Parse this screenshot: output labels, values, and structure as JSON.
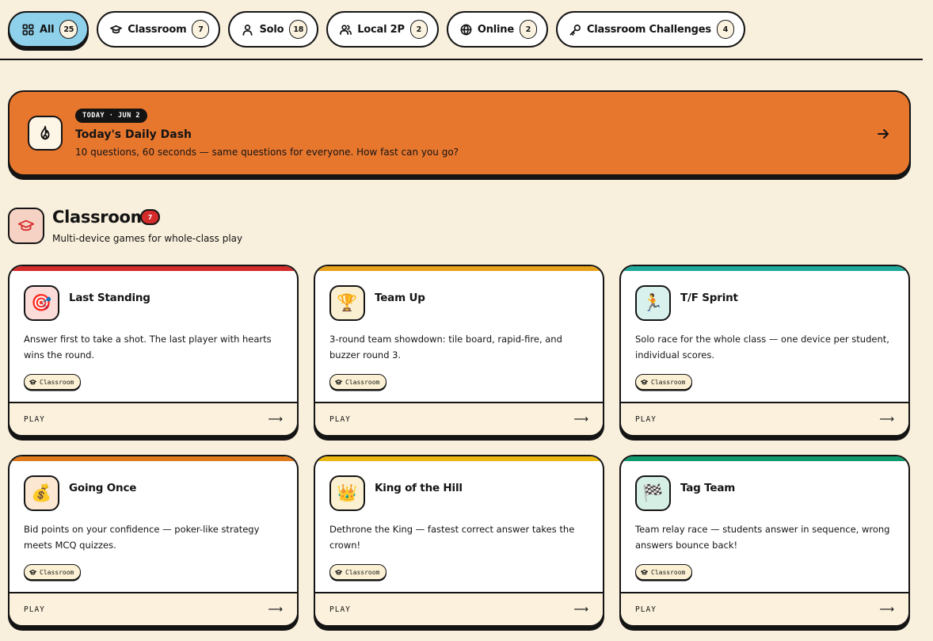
{
  "filters": [
    {
      "label": "All",
      "count": "25",
      "icon": "grid-icon",
      "active": true
    },
    {
      "label": "Classroom",
      "count": "7",
      "icon": "graduation-cap-icon"
    },
    {
      "label": "Solo",
      "count": "18",
      "icon": "user-icon"
    },
    {
      "label": "Local 2P",
      "count": "2",
      "icon": "users-icon"
    },
    {
      "label": "Online",
      "count": "2",
      "icon": "globe-icon"
    },
    {
      "label": "Classroom Challenges",
      "count": "4",
      "icon": "key-icon"
    }
  ],
  "daily": {
    "badge": "TODAY · JUN 2",
    "title": "Today's Daily Dash",
    "description": "10 questions, 60 seconds — same questions for everyone. How fast can you go?",
    "icon": "flame-icon",
    "color": "#e8772e"
  },
  "section": {
    "title": "Classroom",
    "count": "7",
    "subtitle": "Multi-device games for whole-class play",
    "icon": "graduation-cap-icon",
    "color": "#d42b2b"
  },
  "cards": [
    {
      "title": "Last Standing",
      "emoji": "🎯",
      "icon": "target-icon",
      "description": "Answer first to take a shot. The last player with hearts wins the round.",
      "tag": "Classroom",
      "play": "PLAY",
      "stripe": "#d42b2b",
      "icon_bg": "#fbdcd8"
    },
    {
      "title": "Team Up",
      "emoji": "🏆",
      "icon": "trophy-icon",
      "description": "3-round team showdown: tile board, rapid-fire, and buzzer round 3.",
      "tag": "Classroom",
      "play": "PLAY",
      "stripe": "#e8a21a",
      "icon_bg": "#fbefd2"
    },
    {
      "title": "T/F Sprint",
      "emoji": "🏃",
      "icon": "runner-icon",
      "description": "Solo race for the whole class — one device per student, individual scores.",
      "tag": "Classroom",
      "play": "PLAY",
      "stripe": "#1fa99a",
      "icon_bg": "#d8f1ec"
    },
    {
      "title": "Going Once",
      "emoji": "💰",
      "icon": "money-bag-icon",
      "description": "Bid points on your confidence — poker-like strategy meets MCQ quizzes.",
      "tag": "Classroom",
      "play": "PLAY",
      "stripe": "#e07a1a",
      "icon_bg": "#fbe7d2"
    },
    {
      "title": "King of the Hill",
      "emoji": "👑",
      "icon": "crown-icon",
      "description": "Dethrone the King — fastest correct answer takes the crown!",
      "tag": "Classroom",
      "play": "PLAY",
      "stripe": "#ecb70f",
      "icon_bg": "#fbf1d2"
    },
    {
      "title": "Tag Team",
      "emoji": "🏁",
      "icon": "checkered-flag-icon",
      "description": "Team relay race — students answer in sequence, wrong answers bounce back!",
      "tag": "Classroom",
      "play": "PLAY",
      "stripe": "#0f9a6e",
      "icon_bg": "#d6efe4"
    }
  ]
}
